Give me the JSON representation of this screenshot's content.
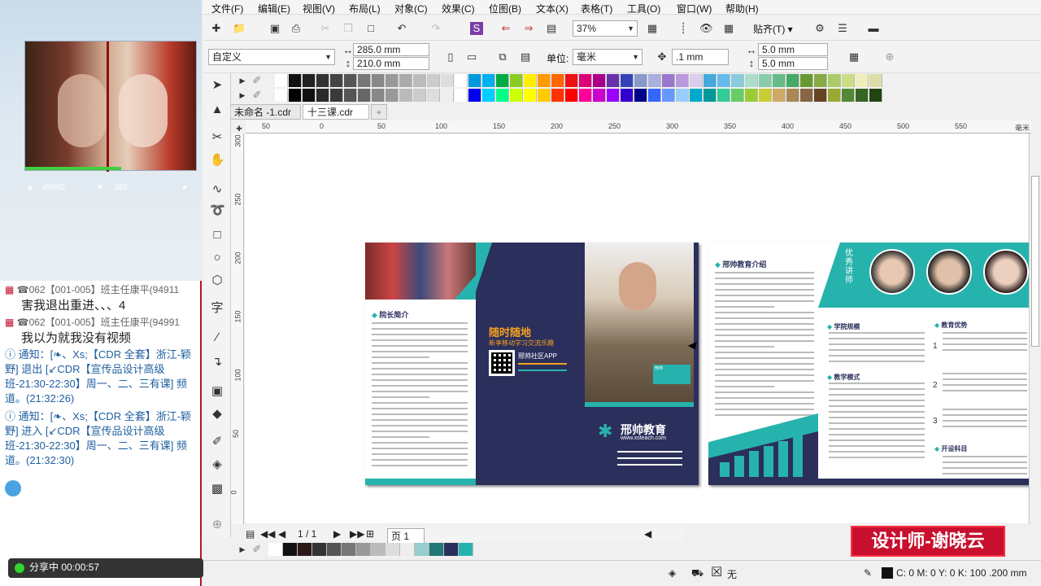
{
  "chat": {
    "stats": {
      "viewers": "49660",
      "likes": "382"
    },
    "messages": [
      {
        "text": "☎062【001-005】班主任康平(94911",
        "kind": "gray"
      },
      {
        "text": "害我退出重进、、、4",
        "kind": "normal"
      },
      {
        "text": "☎062【001-005】班主任康平(94991",
        "kind": "gray"
      },
      {
        "text": "我以为就我没有视频",
        "kind": "normal"
      },
      {
        "text": "通知：[❧、Xs;【CDR 全套】浙江-颖野] 退出 [↙CDR【宣传品设计高级班-21:30-22:30】周一、二、三有课] 频道。(21:32:26)",
        "kind": "sys"
      },
      {
        "text": "通知：[❧、Xs;【CDR 全套】浙江-颖野] 进入 [↙CDR【宣传品设计高级班-21:30-22:30】周一、二、三有课] 频道。(21:32:30)",
        "kind": "sys"
      }
    ]
  },
  "menu": [
    "文件(F)",
    "编辑(E)",
    "视图(V)",
    "布局(L)",
    "对象(C)",
    "效果(C)",
    "位图(B)",
    "文本(X)",
    "表格(T)",
    "工具(O)",
    "窗口(W)",
    "帮助(H)"
  ],
  "toolbar": {
    "zoom": "37%",
    "snap": "贴齐(T)",
    "preset": "自定义",
    "width": "285.0 mm",
    "height": "210.0 mm",
    "unit_label": "单位:",
    "unit": "毫米",
    "nudge": ".1 mm",
    "dup_x": "5.0 mm",
    "dup_y": "5.0 mm"
  },
  "tabs": [
    "未命名 -1.cdr",
    "十三课.cdr"
  ],
  "ruler": {
    "h_ticks": [
      "50",
      "0",
      "50",
      "100",
      "150",
      "200",
      "250",
      "300",
      "350",
      "400",
      "450",
      "500",
      "550"
    ],
    "h_unit": "毫米",
    "v_ticks": [
      "300",
      "250",
      "200",
      "150",
      "100",
      "50",
      "0"
    ]
  },
  "brochure": {
    "left": {
      "section1": "院长简介",
      "slogan1": "随时随地",
      "slogan2": "新享移动学习交流乐趣",
      "app_label": "邢帅社区APP",
      "brand": "邢帅教育",
      "url": "www.xsteach.com",
      "badge": "邢帅"
    },
    "right": {
      "intro": "邢帅教育介绍",
      "teachers_label": "优秀讲师",
      "section_courses": "学院规模",
      "section_mode": "教学模式",
      "section_adv": "教育优势",
      "section_sub": "开设科目",
      "adv_nums": [
        "1",
        "2",
        "3"
      ]
    }
  },
  "pagebar": {
    "current": "1 / 1",
    "page_tab": "页 1"
  },
  "status": {
    "share": "分享中 00:00:57",
    "fill": "无",
    "color_info": "C: 0 M: 0 Y: 0 K: 100  .200 mm"
  },
  "watermark": "设计师-谢晓云",
  "colors": {
    "navy": "#2b2f5c",
    "teal": "#27b3ad",
    "accent_red": "#c8102e"
  }
}
